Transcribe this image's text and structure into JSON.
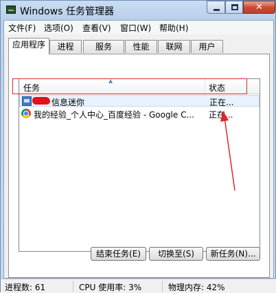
{
  "window": {
    "title": "Windows 任务管理器",
    "close_glyph": "✕"
  },
  "menu": [
    "文件(F)",
    "选项(O)",
    "查看(V)",
    "窗口(W)",
    "帮助(H)"
  ],
  "tabs": [
    "应用程序",
    "进程",
    "服务",
    "性能",
    "联网",
    "用户"
  ],
  "active_tab": "应用程序",
  "list": {
    "columns": {
      "task": "任务",
      "status": "状态"
    },
    "sort_arrow": "▲",
    "rows": [
      {
        "name": "信息迷你",
        "status": "正在...",
        "icon": "message-app-icon",
        "selected": true
      },
      {
        "name": "我的经验_个人中心_百度经验 - Google C...",
        "status": "正在...",
        "icon": "chrome-icon",
        "selected": false
      }
    ]
  },
  "buttons": {
    "end_task": "结束任务(E)",
    "switch_to": "切换至(S)",
    "new_task": "新任务(N)..."
  },
  "status_bar": {
    "processes": "进程数: 61",
    "cpu": "CPU 使用率: 3%",
    "memory": "物理内存: 42%"
  },
  "colors": {
    "annotation": "#e0252b",
    "redaction": "#e4101b"
  }
}
